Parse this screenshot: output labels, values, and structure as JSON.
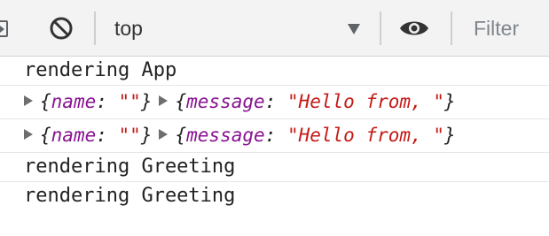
{
  "toolbar": {
    "context": "top",
    "filter_placeholder": "Filter",
    "icons": [
      "sidebar-toggle-icon",
      "clear-console-icon",
      "dropdown-arrow-icon",
      "eye-icon"
    ]
  },
  "console": {
    "first_line": "rendering App",
    "object_rows": [
      {
        "left": {
          "open": "{",
          "key": "name",
          "colon": ": ",
          "value": "\"\"",
          "close": "}"
        },
        "right": {
          "open": "{",
          "key": "message",
          "colon": ": ",
          "value": "\"Hello from, \"",
          "close": "}"
        }
      },
      {
        "left": {
          "open": "{",
          "key": "name",
          "colon": ": ",
          "value": "\"\"",
          "close": "}"
        },
        "right": {
          "open": "{",
          "key": "message",
          "colon": ": ",
          "value": "\"Hello from, \"",
          "close": "}"
        }
      }
    ],
    "greeting_lines": [
      "rendering Greeting",
      "rendering Greeting"
    ]
  },
  "colors": {
    "toolbar_bg": "#f3f3f3",
    "object_key": "#881391",
    "string_value": "#c41a16",
    "log_text": "#222222"
  }
}
